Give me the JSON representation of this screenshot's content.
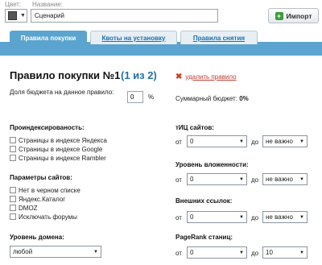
{
  "header": {
    "color_label": "Цвет:",
    "name_label": "Название:",
    "name_value": "Сценарий",
    "import_label": "Импорт"
  },
  "tabs": [
    {
      "label": "Правила покупки",
      "active": true
    },
    {
      "label": "Квоты на установку",
      "active": false
    },
    {
      "label": "Правила снятия",
      "active": false
    }
  ],
  "rule": {
    "title": "Правило покупки №1",
    "count": "(1 из 2)",
    "delete_label": "удалить правило",
    "budget_label": "Доля бюджета на данное правило:",
    "budget_value": "0",
    "budget_unit": "%",
    "total_budget_label": "Суммарный бюджет:",
    "total_budget_value": "0%"
  },
  "indexing": {
    "title": "Проиндексированость:",
    "items": [
      "Страницы в индексе Яндекса",
      "Страницы в индексе Google",
      "Страницы в индексе Rambler"
    ]
  },
  "site_params": {
    "title": "Параметры сайтов:",
    "items": [
      "Нет в черном списке",
      "Яндекс.Каталог",
      "DMOZ",
      "Исключать форумы"
    ]
  },
  "domain_level": {
    "title": "Уровень домена:",
    "value": "любой"
  },
  "filters": {
    "from_label": "от",
    "to_label": "до",
    "tic": {
      "title": "тИЦ сайтов:",
      "from": "0",
      "to": "не важно"
    },
    "nesting": {
      "title": "Уровень вложенности:",
      "from": "0",
      "to": "не важно"
    },
    "outlinks": {
      "title": "Внешних ссылок:",
      "from": "0",
      "to": "не важно"
    },
    "pagerank": {
      "title": "PageRank станиц:",
      "from": "0",
      "to": "10"
    }
  }
}
